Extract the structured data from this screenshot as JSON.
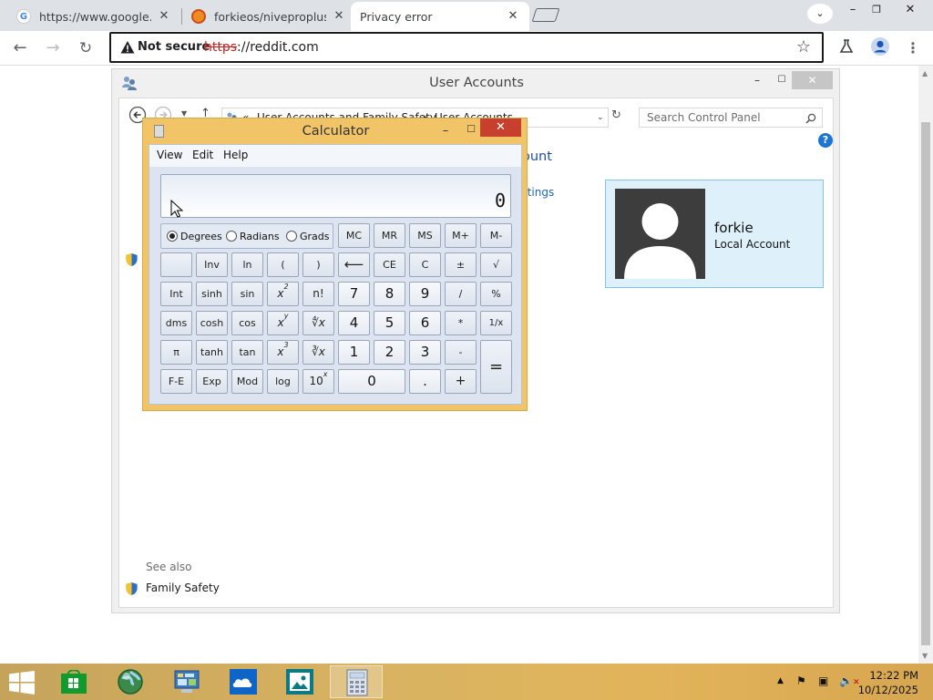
{
  "browser": {
    "tabs": [
      {
        "title": "https://www.google.com",
        "active": false,
        "icon": "google-icon"
      },
      {
        "title": "forkieos/niveproplusos",
        "active": false,
        "icon": "firefox-style-icon"
      },
      {
        "title": "Privacy error",
        "active": true,
        "icon": "none"
      }
    ],
    "security_label": "Not secure",
    "url_scheme": "https",
    "url_rest": "://reddit.com"
  },
  "user_accounts": {
    "title": "User Accounts",
    "breadcrumb_prefix": "«",
    "breadcrumb": [
      "User Accounts and Family Safety",
      "User Accounts"
    ],
    "search_placeholder": "Search Control Panel",
    "partial_heading": "ount",
    "partial_link": "ttings",
    "user_name": "forkie",
    "user_type": "Local Account",
    "see_also": "See also",
    "family_safety": "Family Safety"
  },
  "calculator": {
    "title": "Calculator",
    "menu": [
      "View",
      "Edit",
      "Help"
    ],
    "display": "0",
    "modes": [
      {
        "label": "Degrees",
        "selected": true
      },
      {
        "label": "Radians",
        "selected": false
      },
      {
        "label": "Grads",
        "selected": false
      }
    ],
    "memory_keys": [
      "MC",
      "MR",
      "MS",
      "M+",
      "M-"
    ],
    "keys": {
      "inv": "Inv",
      "ln": "ln",
      "lparen": "(",
      "rparen": ")",
      "back": "⟵",
      "ce": "CE",
      "c": "C",
      "plusminus": "±",
      "sqrt": "√",
      "int": "Int",
      "sinh": "sinh",
      "sin": "sin",
      "x2": "x",
      "x2sup": "2",
      "fact": "n!",
      "d7": "7",
      "d8": "8",
      "d9": "9",
      "div": "/",
      "pct": "%",
      "dms": "dms",
      "cosh": "cosh",
      "cos": "cos",
      "xy": "x",
      "xysup": "y",
      "yroot": "∜x",
      "d4": "4",
      "d5": "5",
      "d6": "6",
      "mul": "*",
      "recip": "1/x",
      "pi": "π",
      "tanh": "tanh",
      "tan": "tan",
      "x3": "x",
      "x3sup": "3",
      "cbrt": "∛x",
      "d1": "1",
      "d2": "2",
      "d3": "3",
      "sub": "-",
      "eq": "=",
      "fe": "F-E",
      "exp": "Exp",
      "mod": "Mod",
      "log": "log",
      "ten": "10",
      "tensup": "x",
      "d0": "0",
      "dot": ".",
      "add": "+"
    }
  },
  "taskbar": {
    "time": "12:22 PM",
    "date": "10/12/2025"
  },
  "colors": {
    "calc_frame": "#f2c468",
    "calc_close": "#c7402d",
    "taskbar": "#d8b362",
    "chrome_tabbar": "#dee1e6",
    "user_card": "#def1fb"
  }
}
